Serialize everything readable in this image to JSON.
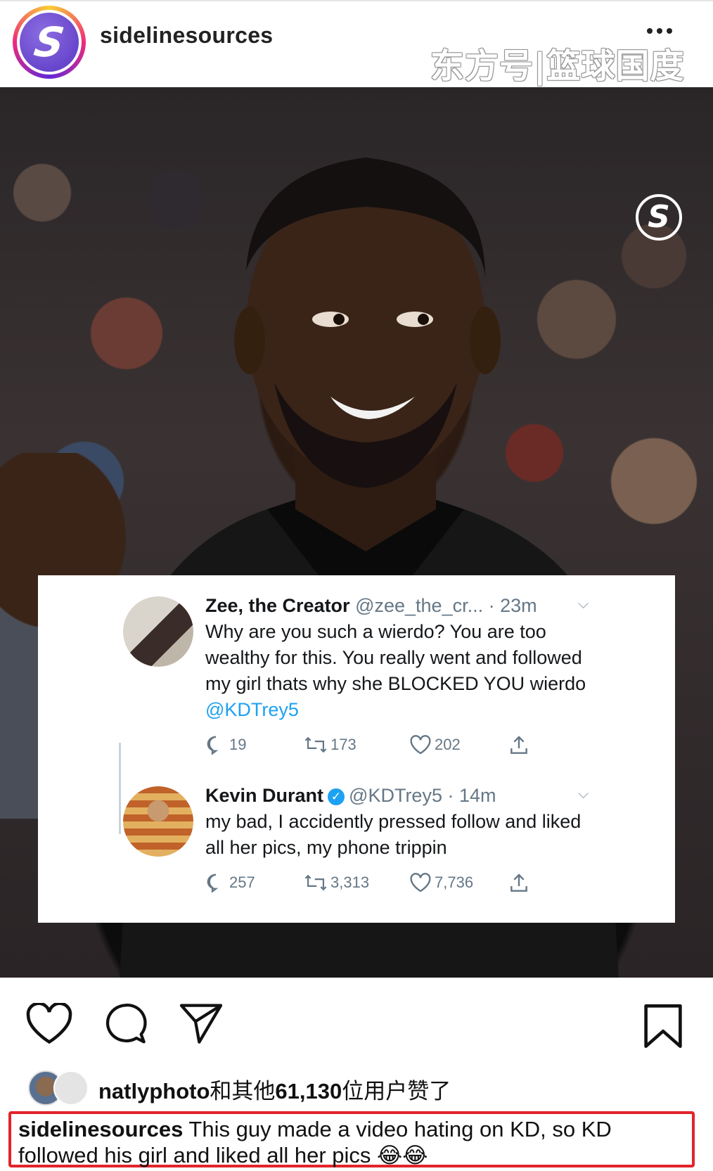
{
  "header": {
    "username": "sidelinesources",
    "avatar_letter": "S",
    "watermark": "东方号|篮球国度",
    "more_icon": "more-horizontal-icon"
  },
  "photo": {
    "logo_letter": "S"
  },
  "tweets": [
    {
      "display_name": "Zee, the Creator",
      "handle": "@zee_the_cr...",
      "time": "· 23m",
      "text": "Why are you such a wierdo? You are too wealthy for this. You really went and followed my girl thats why she BLOCKED YOU wierdo",
      "mention": "@KDTrey5",
      "replies": "19",
      "retweets": "173",
      "likes": "202"
    },
    {
      "display_name": "Kevin Durant",
      "handle": "@KDTrey5",
      "time": "· 14m",
      "verified": true,
      "text": "my bad, I accidently pressed follow and liked all her pics, my phone trippin",
      "replies": "257",
      "retweets": "3,313",
      "likes": "7,736"
    }
  ],
  "action_bar": {
    "icons": [
      "heart-icon",
      "comment-icon",
      "share-icon",
      "bookmark-icon"
    ]
  },
  "likes": {
    "user": "natlyphoto",
    "text": "和其他",
    "count": "61,130",
    "suffix": "位用户赞了"
  },
  "caption": {
    "username": "sidelinesources",
    "text": "This guy made a video hating on KD, so KD followed his girl and liked all her pics",
    "emoji": "😂😂"
  },
  "colors": {
    "highlight_border": "#e2242b",
    "twitter_blue": "#1da1f2"
  }
}
